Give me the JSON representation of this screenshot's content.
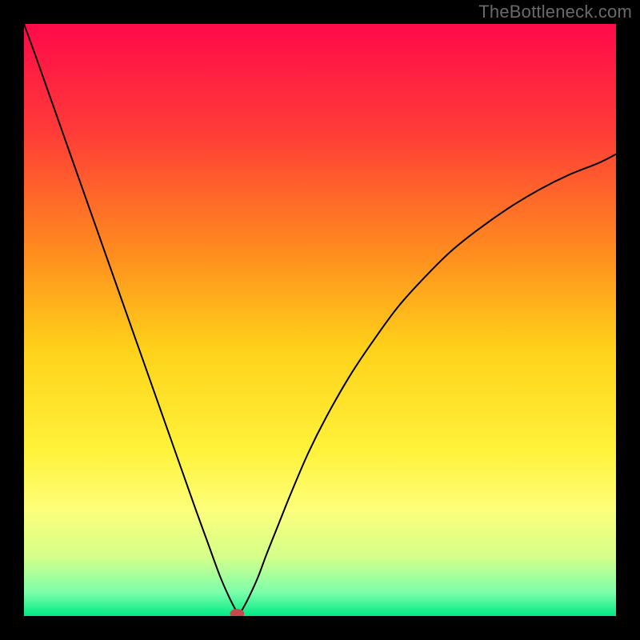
{
  "attribution": "TheBottleneck.com",
  "chart_data": {
    "type": "line",
    "title": "",
    "xlabel": "",
    "ylabel": "",
    "xlim": [
      0,
      100
    ],
    "ylim": [
      0,
      100
    ],
    "background_gradient": [
      {
        "pos": 0.0,
        "color": "#ff0a4a"
      },
      {
        "pos": 0.18,
        "color": "#ff3b38"
      },
      {
        "pos": 0.38,
        "color": "#ff8a1f"
      },
      {
        "pos": 0.55,
        "color": "#ffd21a"
      },
      {
        "pos": 0.72,
        "color": "#fff23a"
      },
      {
        "pos": 0.82,
        "color": "#fdff7a"
      },
      {
        "pos": 0.9,
        "color": "#d4ff8a"
      },
      {
        "pos": 0.96,
        "color": "#7dffab"
      },
      {
        "pos": 1.0,
        "color": "#00e884"
      }
    ],
    "series": [
      {
        "name": "bottleneck-curve",
        "color": "#000000",
        "x": [
          0,
          2,
          5,
          8,
          11,
          14,
          17,
          20,
          23,
          26,
          29,
          31,
          33,
          34.5,
          35.5,
          36,
          36.5,
          37,
          38,
          39.5,
          41,
          43,
          45,
          48,
          51,
          55,
          59,
          63,
          67,
          72,
          77,
          82,
          87,
          92,
          97,
          100
        ],
        "y": [
          100,
          94.5,
          86,
          77.5,
          69,
          60.5,
          52,
          43.5,
          35,
          26.5,
          18,
          12.5,
          7,
          3.5,
          1.5,
          0.6,
          0.6,
          1.3,
          3.2,
          6.5,
          10.5,
          15.5,
          20.5,
          27.5,
          33.5,
          40.5,
          46.5,
          52,
          56.5,
          61.5,
          65.5,
          69,
          72,
          74.5,
          76.5,
          78
        ]
      }
    ],
    "marker": {
      "x": 36,
      "y": 0.4,
      "color": "#c64a4a",
      "rx": 1.2,
      "ry": 0.8
    }
  }
}
